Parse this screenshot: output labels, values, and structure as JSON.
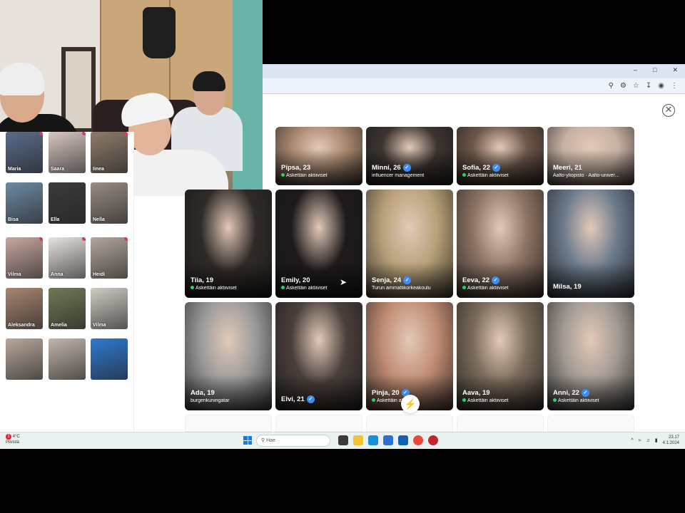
{
  "browser": {
    "window_controls": [
      "–",
      "□",
      "✕"
    ],
    "toolbar_icons": [
      "location-icon",
      "extensions-icon",
      "star-icon",
      "download-icon",
      "profile-icon",
      "menu-icon"
    ],
    "close_symbol": "✕"
  },
  "sidebar_thumbs": [
    {
      "name": "Maria",
      "dot": true,
      "color": "#5a6c8c"
    },
    {
      "name": "Saara",
      "dot": true,
      "color": "#d9c7c1"
    },
    {
      "name": "Iinea",
      "dot": true,
      "color": "#8f7c6b"
    },
    {
      "name": "Bisa",
      "dot": false,
      "color": "#6e8aa4"
    },
    {
      "name": "Ella",
      "dot": false,
      "color": "#3b3b3b"
    },
    {
      "name": "Nella",
      "dot": false,
      "color": "#9a8d84"
    },
    {
      "name": "Vilma",
      "dot": true,
      "color": "#c8a7a0"
    },
    {
      "name": "Anna",
      "dot": true,
      "color": "#e7e3df"
    },
    {
      "name": "Heidi",
      "dot": true,
      "color": "#b3a79d"
    },
    {
      "name": "Aleksandra",
      "dot": false,
      "color": "#a88670"
    },
    {
      "name": "Amelia",
      "dot": false,
      "color": "#6f7a55"
    },
    {
      "name": "Vilma",
      "dot": false,
      "color": "#d1cbc4"
    },
    {
      "name": "",
      "dot": false,
      "color": "#b9a89c"
    },
    {
      "name": "",
      "dot": false,
      "color": "#c2b6ac"
    },
    {
      "name": "",
      "dot": false,
      "color": "#2f7ad0"
    }
  ],
  "cards": [
    {
      "name": "Pipsa, 23",
      "verified": false,
      "sub": "Äskettäin aktiiviset",
      "active": true,
      "color": "#a8876e"
    },
    {
      "name": "Minni, 26",
      "verified": true,
      "sub": "influencer management",
      "active": false,
      "color": "#3d3430"
    },
    {
      "name": "Sofia, 22",
      "verified": true,
      "sub": "Äskettäin aktiiviset",
      "active": true,
      "color": "#6b5548"
    },
    {
      "name": "Meeri, 21",
      "verified": false,
      "sub": "Aalto-yliopisto · Aalto-univer...",
      "active": false,
      "color": "#c6b0a2"
    },
    {
      "name": "Tiia, 19",
      "verified": false,
      "sub": "Äskettäin aktiiviset",
      "active": true,
      "color": "#2f2a27"
    },
    {
      "name": "Emily, 20",
      "verified": false,
      "sub": "Äskettäin aktiiviset",
      "active": true,
      "color": "#1e1a1c"
    },
    {
      "name": "Senja, 24",
      "verified": true,
      "sub": "Turun ammattikorkeakoulu",
      "active": false,
      "color": "#b8a07a"
    },
    {
      "name": "Eeva, 22",
      "verified": true,
      "sub": "Äskettäin aktiiviset",
      "active": true,
      "color": "#8c7263"
    },
    {
      "name": "Milsa, 19",
      "verified": false,
      "sub": "",
      "active": false,
      "color": "#6b7a8c"
    },
    {
      "name": "Ada, 19",
      "verified": false,
      "sub": "burgerikuningatar",
      "active": false,
      "color": "#9a9a9a"
    },
    {
      "name": "Elvi, 21",
      "verified": true,
      "sub": "",
      "active": false,
      "color": "#4a3f3b"
    },
    {
      "name": "Pinja, 20",
      "verified": true,
      "sub": "Äskettäin aktiiviset",
      "active": true,
      "color": "#c18c73"
    },
    {
      "name": "Aava, 19",
      "verified": false,
      "sub": "Äskettäin aktiiviset",
      "active": true,
      "color": "#7a6a5a"
    },
    {
      "name": "Anni, 22",
      "verified": true,
      "sub": "Äskettäin aktiiviset",
      "active": true,
      "color": "#a29a93"
    }
  ],
  "taskbar": {
    "weather_line1": "4°C",
    "weather_line2": "Pilvistä",
    "search_placeholder": "Hae",
    "clock_time": "23.17",
    "clock_date": "4.1.2024"
  }
}
